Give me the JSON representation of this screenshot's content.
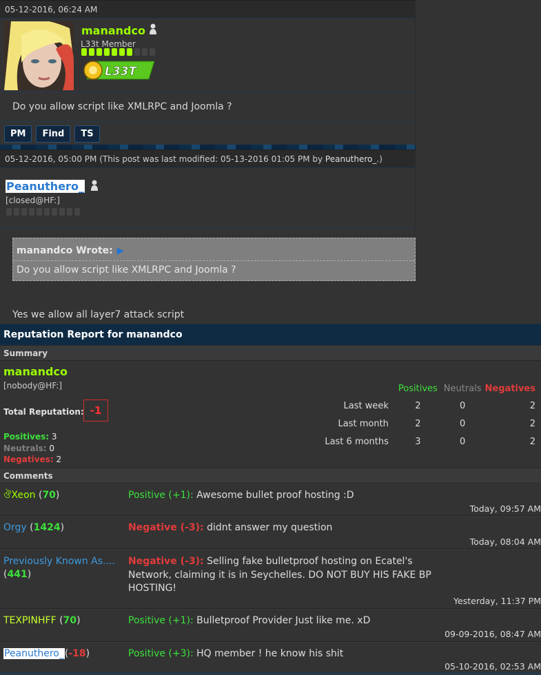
{
  "post1": {
    "date": "05-12-2016, 06:24 AM",
    "username": "manandco",
    "usertitle": "L33t Member",
    "stars_filled": 7,
    "stars_total": 10,
    "award_label": "L33T",
    "message": "Do you allow script like XMLRPC and Joomla ?",
    "buttons": [
      "PM",
      "Find",
      "TS"
    ]
  },
  "post2": {
    "date": "05-12-2016, 05:00 PM",
    "modified_prefix": "(This post was last modified: 05-13-2016 01:05 PM by ",
    "modified_by": "Peanuthero_",
    "modified_suffix": ".)",
    "username": "Peanuthero_",
    "usertitle": "[closed@HF:]",
    "stars_filled": 0,
    "stars_total": 10,
    "quote_author": "manandco Wrote:",
    "quote_text": "Do you allow script like XMLRPC and Joomla ?",
    "reply": "Yes we allow all layer7 attack script"
  },
  "rep": {
    "title": "Reputation Report for manandco",
    "summary_label": "Summary",
    "username": "manandco",
    "handle": "[nobody@HF:]",
    "total_label": "Total Reputation:",
    "total_value": "-1",
    "positives_label": "Positives:",
    "positives": "3",
    "neutrals_label": "Neutrals:",
    "neutrals": "0",
    "negatives_label": "Negatives:",
    "negatives": "2",
    "col_positives": "Positives",
    "col_neutrals": "Neutrals",
    "col_negatives": "Negatives",
    "rows": [
      {
        "period": "Last week",
        "pos": "2",
        "neu": "0",
        "neg": "2"
      },
      {
        "period": "Last month",
        "pos": "2",
        "neu": "0",
        "neg": "2"
      },
      {
        "period": "Last 6 months",
        "pos": "3",
        "neu": "0",
        "neg": "2"
      }
    ],
    "comments_label": "Comments",
    "comments": [
      {
        "user": "ঔXeon",
        "count": "70",
        "type": "Positive (+1):",
        "text": "Awesome bullet proof hosting :D",
        "date": "Today, 09:57 AM"
      },
      {
        "user": "Orgy",
        "count": "1424",
        "type": "Negative (-3):",
        "text": "didnt answer my question",
        "date": "Today, 08:04 AM"
      },
      {
        "user": "Previously Known As....",
        "count": "441",
        "type": "Negative (-3):",
        "text": "Selling fake bulletproof hosting on Ecatel's Network, claiming it is in Seychelles. DO NOT BUY HIS FAKE BP HOSTING!",
        "date": "Yesterday, 11:37 PM"
      },
      {
        "user": "TEXPINHFF",
        "count": "70",
        "type": "Positive (+1):",
        "text": "Bulletproof Provider Just like me. xD",
        "date": "09-09-2016, 08:47 AM"
      },
      {
        "user": "Peanuthero_",
        "count": "-18",
        "type": "Positive (+3):",
        "text": "HQ member ! he know his shit",
        "date": "05-10-2016, 02:53 AM"
      }
    ]
  },
  "colors": {
    "username_green": "#9bff00",
    "positive": "#3ce03c",
    "negative": "#e23b3b",
    "header_blue": "#0f2b44",
    "link_blue": "#3d9be0"
  },
  "icons": [
    "online-status-icon",
    "l33t-award-icon",
    "quote-arrow-icon"
  ]
}
